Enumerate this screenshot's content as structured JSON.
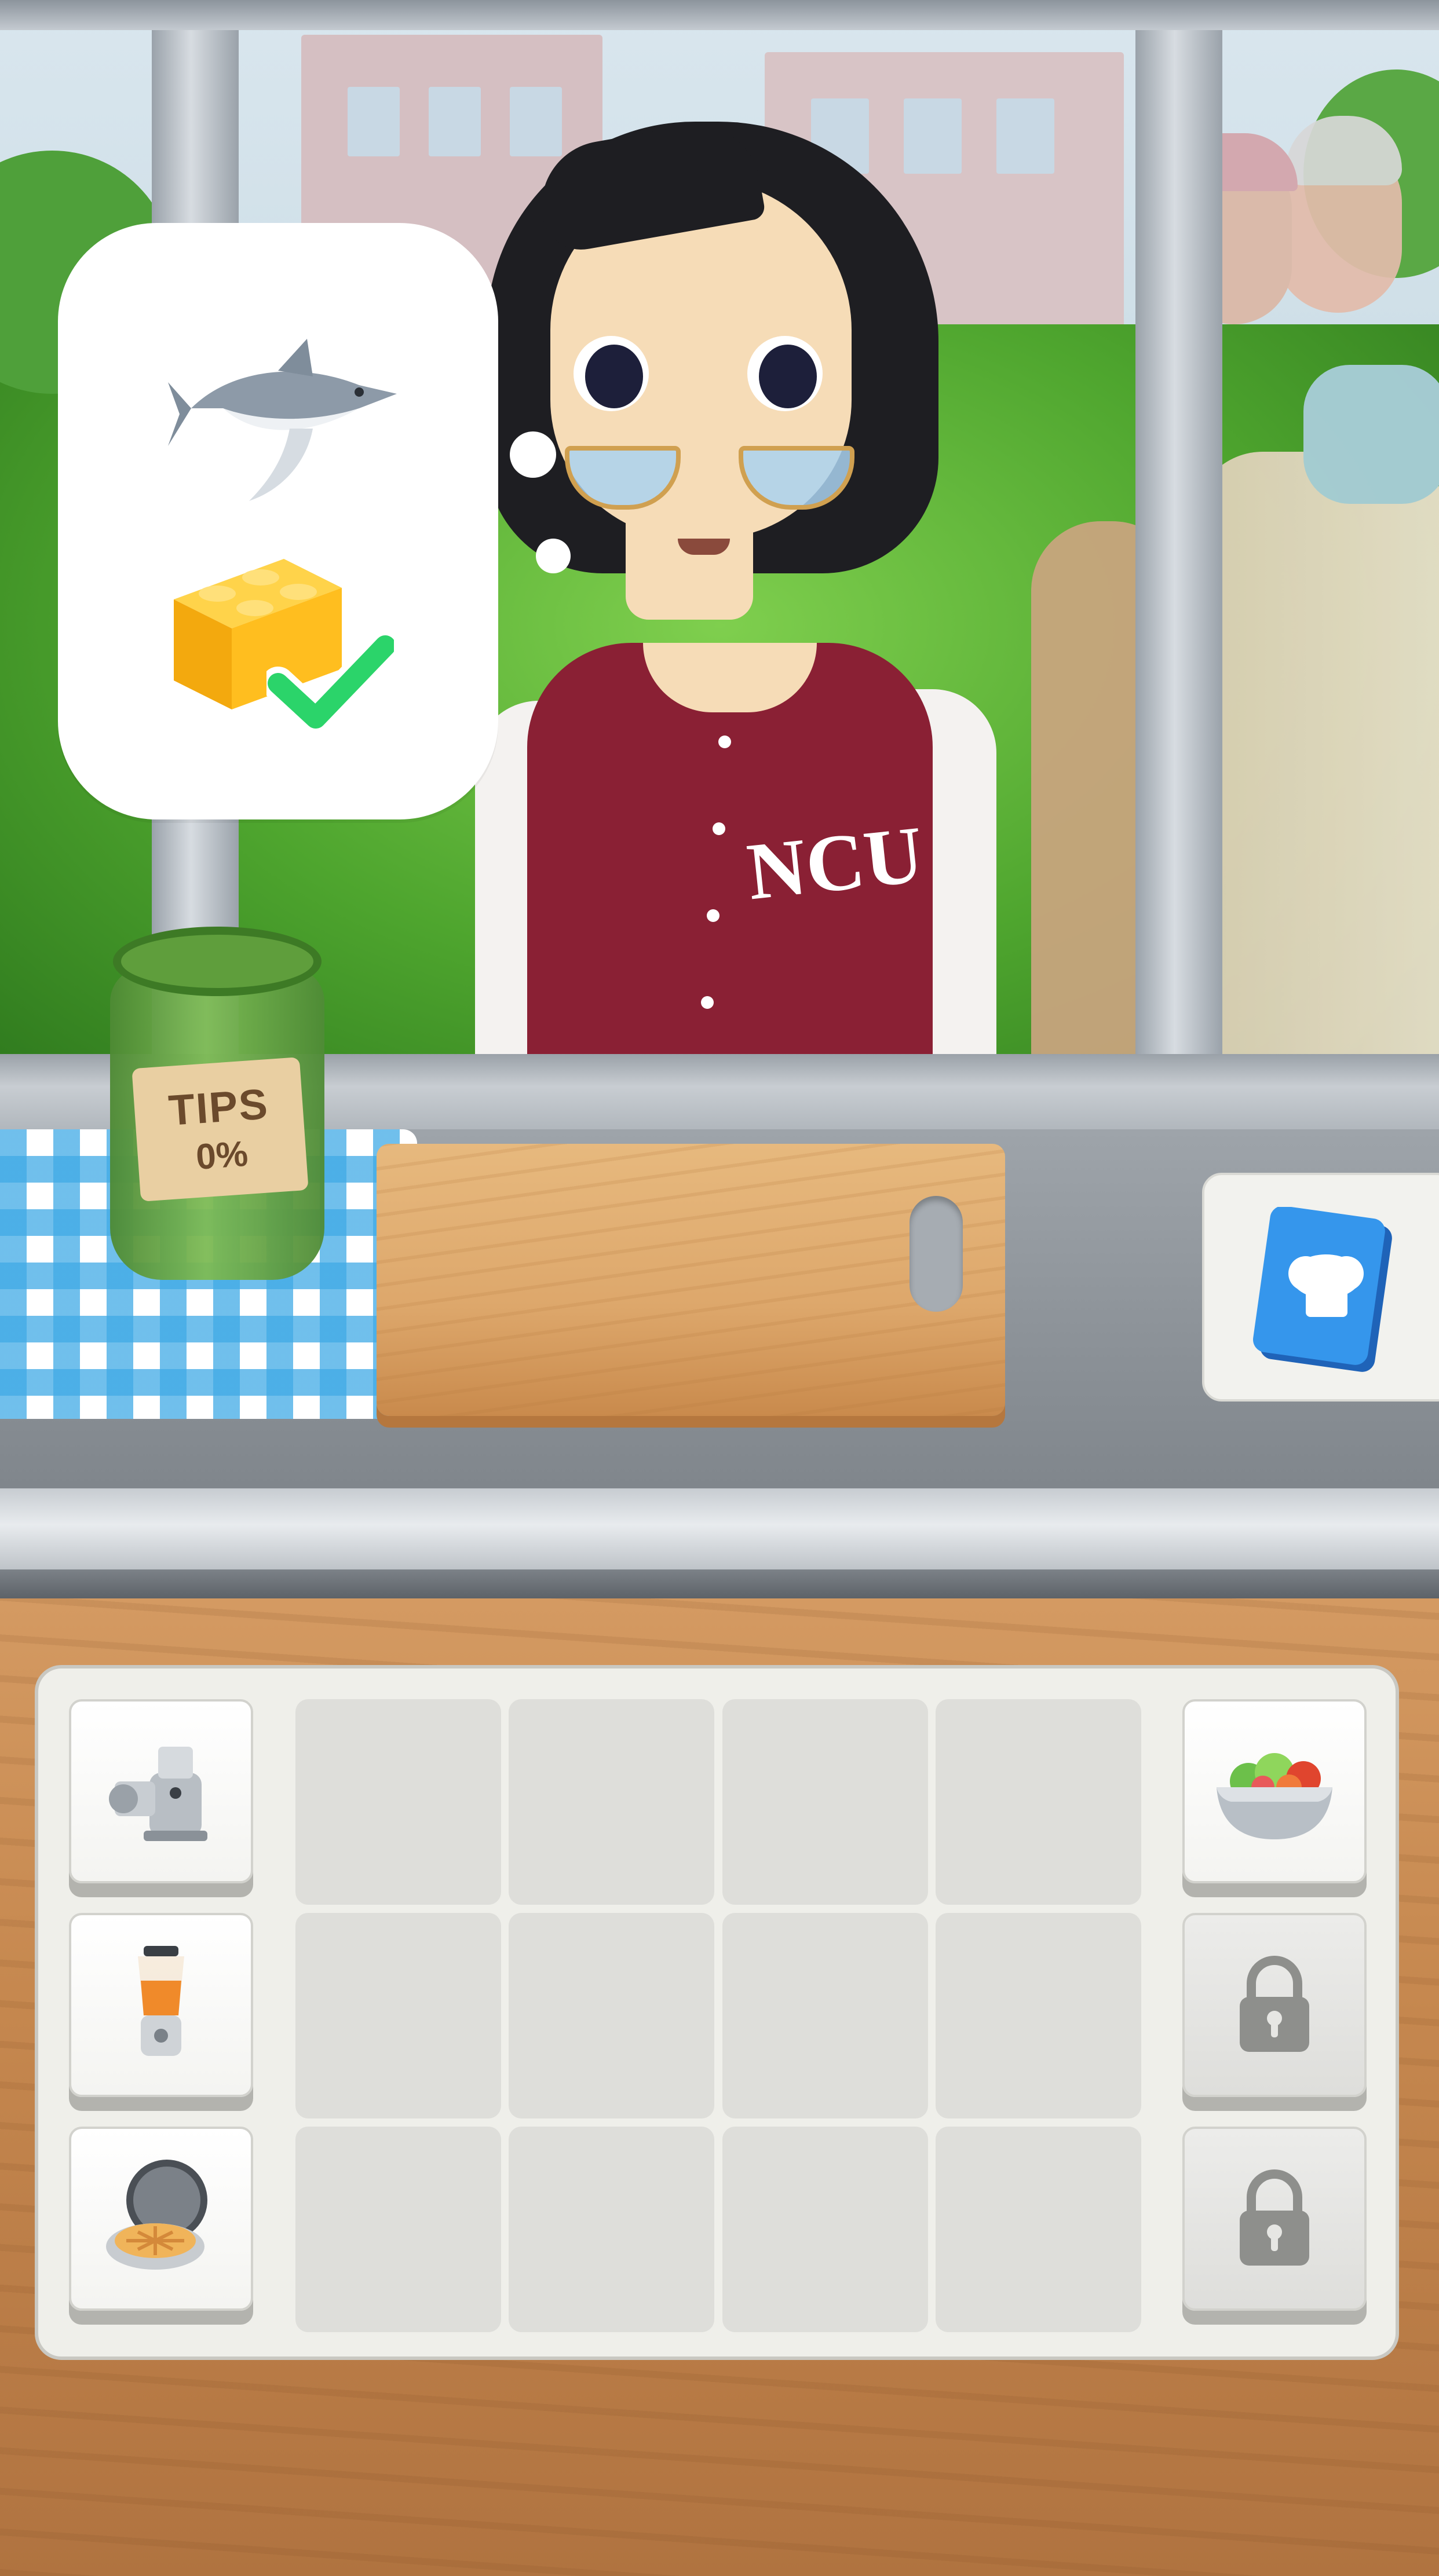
{
  "tip_jar": {
    "title": "TIPS",
    "percent": "0%"
  },
  "customer": {
    "jacket_text": "NCU"
  },
  "order_bubble": {
    "items": [
      {
        "icon": "shark-icon",
        "status": "pending"
      },
      {
        "icon": "yellow-block-icon",
        "status": "done"
      }
    ]
  },
  "recipe_book": {
    "icon": "recipe-book-icon"
  },
  "inventory": {
    "left_tools": [
      {
        "icon": "meat-grinder-icon"
      },
      {
        "icon": "blender-icon"
      },
      {
        "icon": "waffle-maker-icon"
      }
    ],
    "right_tools": [
      {
        "icon": "salad-bowl-icon",
        "locked": false
      },
      {
        "icon": "lock-icon",
        "locked": true
      },
      {
        "icon": "lock-icon",
        "locked": true
      }
    ],
    "grid_rows": 3,
    "grid_cols": 4
  },
  "colors": {
    "jacket": "#8a2034",
    "check": "#2bd46a",
    "cloth": "#40aae6",
    "book": "#2f86e0"
  }
}
